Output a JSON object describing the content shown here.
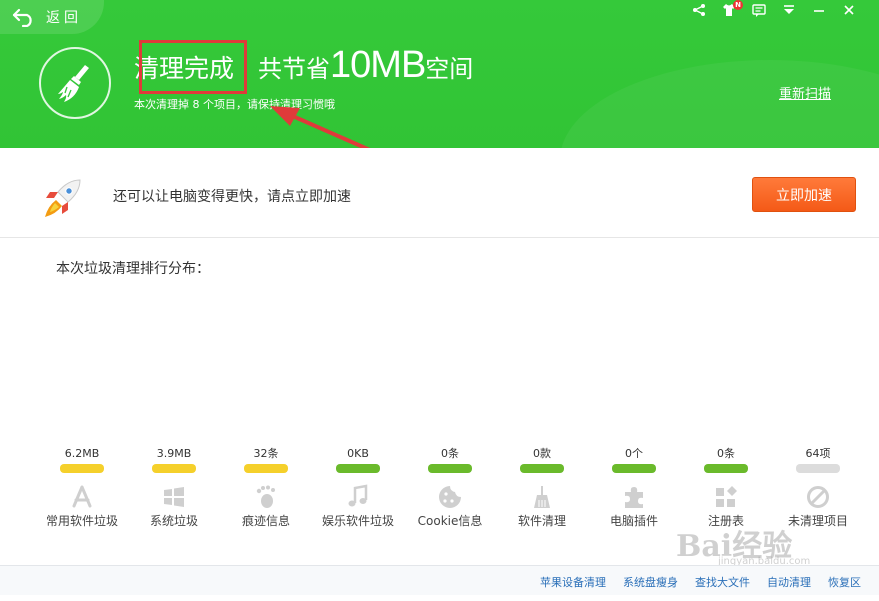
{
  "header": {
    "back_label": "返回",
    "title_done": "清理完成",
    "title_saved_prefix": "共节省",
    "title_saved_size": "10MB",
    "title_saved_suffix": "空间",
    "subtitle": "本次清理掉 8 个项目，请保持清理习惯哦",
    "rescan_label": "重新扫描",
    "notification_badge": "N",
    "icons": [
      "share-icon",
      "shirt-skin-icon",
      "message-icon",
      "menu-icon",
      "minimize-icon",
      "close-icon"
    ],
    "bg_color": "#31c435"
  },
  "speed": {
    "text": "还可以让电脑变得更快，请点立即加速",
    "button_label": "立即加速",
    "button_color": "#f45a17"
  },
  "distribution_title": "本次垃圾清理排行分布：",
  "categories": [
    {
      "value": "6.2MB",
      "label": "常用软件垃圾",
      "bar_color": "#f5d02b",
      "icon": "app-store-icon"
    },
    {
      "value": "3.9MB",
      "label": "系统垃圾",
      "bar_color": "#f5d02b",
      "icon": "windows-icon"
    },
    {
      "value": "32条",
      "label": "痕迹信息",
      "bar_color": "#f5d02b",
      "icon": "footprint-icon"
    },
    {
      "value": "0KB",
      "label": "娱乐软件垃圾",
      "bar_color": "#6aba2b",
      "icon": "music-note-icon"
    },
    {
      "value": "0条",
      "label": "Cookie信息",
      "bar_color": "#6aba2b",
      "icon": "cookie-icon"
    },
    {
      "value": "0款",
      "label": "软件清理",
      "bar_color": "#6aba2b",
      "icon": "broom-icon"
    },
    {
      "value": "0个",
      "label": "电脑插件",
      "bar_color": "#6aba2b",
      "icon": "puzzle-icon"
    },
    {
      "value": "0条",
      "label": "注册表",
      "bar_color": "#6aba2b",
      "icon": "registry-blocks-icon"
    },
    {
      "value": "64项",
      "label": "未清理项目",
      "bar_color": "#dcdcdc",
      "icon": "prohibited-icon"
    }
  ],
  "footer_links": [
    "苹果设备清理",
    "系统盘瘦身",
    "查找大文件",
    "自动清理",
    "恢复区"
  ],
  "annotation_color": "#e03a3a",
  "watermark": {
    "main": "Bai经验",
    "sub": "jingyan.baidu.com"
  }
}
